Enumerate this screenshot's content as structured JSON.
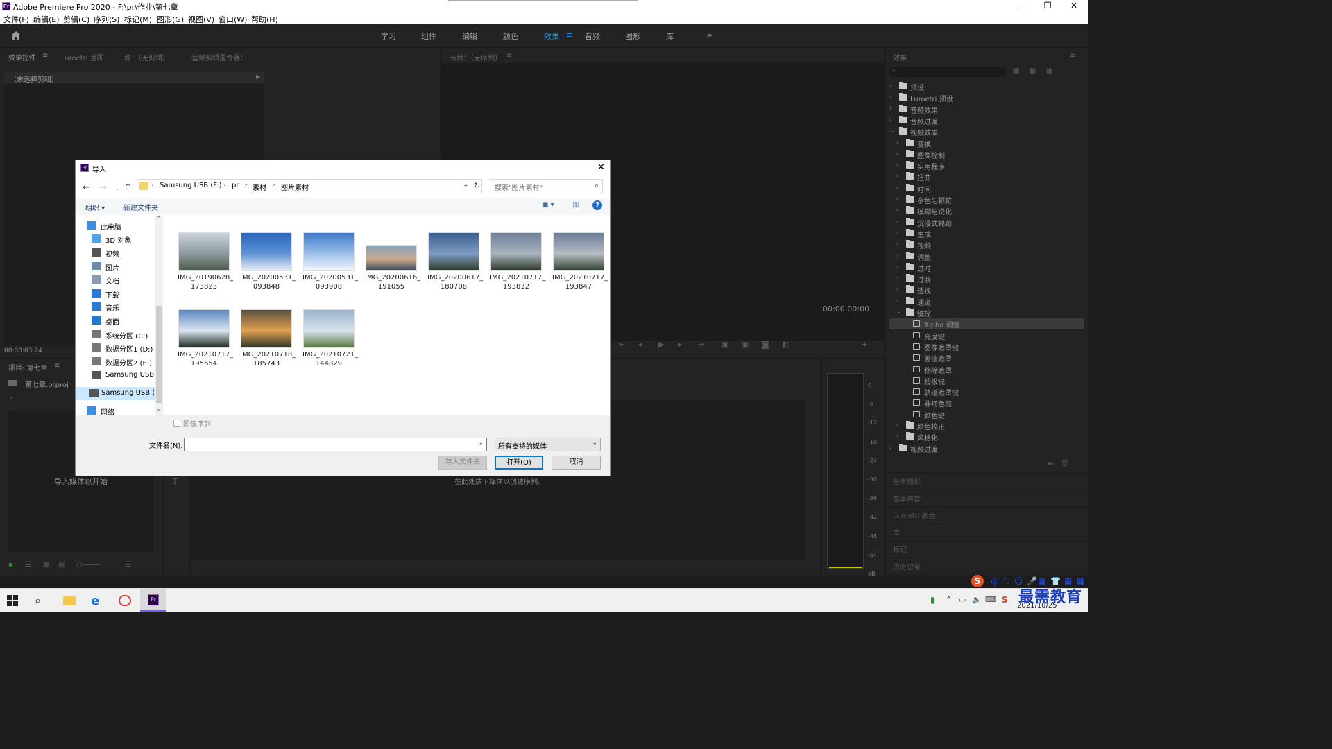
{
  "window": {
    "title": "Adobe Premiere Pro 2020 - F:\\pr\\作业\\第七章",
    "app_icon": "Pr",
    "minimize": "—",
    "maximize": "❐",
    "close": "✕"
  },
  "menu": [
    "文件(F)",
    "编辑(E)",
    "剪辑(C)",
    "序列(S)",
    "标记(M)",
    "图形(G)",
    "视图(V)",
    "窗口(W)",
    "帮助(H)"
  ],
  "workspaces": {
    "tabs": [
      "学习",
      "组件",
      "编辑",
      "颜色",
      "效果",
      "音频",
      "图形",
      "库"
    ],
    "active": "效果",
    "overflow": "»",
    "active_menu": "≡"
  },
  "left_panel": {
    "tabs": [
      "效果控件",
      "Lumetri 范围",
      "源：（无剪辑）",
      "音频剪辑混合器："
    ],
    "tab_menu": "≡",
    "no_clip": "（未选择剪辑）",
    "timecode": "00:00:03:24"
  },
  "program_monitor": {
    "tab": "节目：（无序列）",
    "tab_menu": "≡",
    "timecode": "00:00:00:00"
  },
  "project_panel": {
    "tab": "项目: 第七章",
    "tab_menu": "≡",
    "file": "第七章.prproj",
    "empty_hint": "导入媒体以开始"
  },
  "timeline": {
    "empty_hint": "在此处放下媒体以创建序列。"
  },
  "audio_meter": {
    "scale": [
      "0",
      "-6",
      "-12",
      "-18",
      "-24",
      "-30",
      "-36",
      "-42",
      "-48",
      "-54",
      "dB"
    ]
  },
  "effects_panel": {
    "title": "效果",
    "menu": "≡",
    "tree": [
      {
        "label": "预设",
        "level": 0,
        "expanded": false,
        "type": "folder-special"
      },
      {
        "label": "Lumetri 预设",
        "level": 0,
        "expanded": false,
        "type": "folder-special"
      },
      {
        "label": "音频效果",
        "level": 0,
        "expanded": false,
        "type": "folder"
      },
      {
        "label": "音频过渡",
        "level": 0,
        "expanded": false,
        "type": "folder"
      },
      {
        "label": "视频效果",
        "level": 0,
        "expanded": true,
        "type": "folder"
      },
      {
        "label": "变换",
        "level": 1,
        "expanded": false,
        "type": "folder"
      },
      {
        "label": "图像控制",
        "level": 1,
        "expanded": false,
        "type": "folder"
      },
      {
        "label": "实用程序",
        "level": 1,
        "expanded": false,
        "type": "folder"
      },
      {
        "label": "扭曲",
        "level": 1,
        "expanded": false,
        "type": "folder"
      },
      {
        "label": "时间",
        "level": 1,
        "expanded": false,
        "type": "folder"
      },
      {
        "label": "杂色与颗粒",
        "level": 1,
        "expanded": false,
        "type": "folder"
      },
      {
        "label": "模糊与锐化",
        "level": 1,
        "expanded": false,
        "type": "folder"
      },
      {
        "label": "沉浸式视频",
        "level": 1,
        "expanded": false,
        "type": "folder"
      },
      {
        "label": "生成",
        "level": 1,
        "expanded": false,
        "type": "folder"
      },
      {
        "label": "视频",
        "level": 1,
        "expanded": false,
        "type": "folder"
      },
      {
        "label": "调整",
        "level": 1,
        "expanded": false,
        "type": "folder"
      },
      {
        "label": "过时",
        "level": 1,
        "expanded": false,
        "type": "folder"
      },
      {
        "label": "过渡",
        "level": 1,
        "expanded": false,
        "type": "folder"
      },
      {
        "label": "透视",
        "level": 1,
        "expanded": false,
        "type": "folder"
      },
      {
        "label": "通道",
        "level": 1,
        "expanded": false,
        "type": "folder"
      },
      {
        "label": "键控",
        "level": 1,
        "expanded": true,
        "type": "folder"
      },
      {
        "label": "Alpha 调整",
        "level": 2,
        "type": "effect",
        "selected": true
      },
      {
        "label": "亮度键",
        "level": 2,
        "type": "effect"
      },
      {
        "label": "图像遮罩键",
        "level": 2,
        "type": "effect"
      },
      {
        "label": "差值遮罩",
        "level": 2,
        "type": "effect"
      },
      {
        "label": "移除遮罩",
        "level": 2,
        "type": "effect"
      },
      {
        "label": "超级键",
        "level": 2,
        "type": "effect"
      },
      {
        "label": "轨道遮罩键",
        "level": 2,
        "type": "effect"
      },
      {
        "label": "非红色键",
        "level": 2,
        "type": "effect"
      },
      {
        "label": "颜色键",
        "level": 2,
        "type": "effect"
      },
      {
        "label": "颜色校正",
        "level": 1,
        "expanded": false,
        "type": "folder"
      },
      {
        "label": "风格化",
        "level": 1,
        "expanded": false,
        "type": "folder"
      },
      {
        "label": "视频过渡",
        "level": 0,
        "expanded": false,
        "type": "folder"
      }
    ],
    "collapsed_panels": [
      "基本图形",
      "基本声音",
      "Lumetri 颜色",
      "库",
      "标记",
      "历史记录"
    ]
  },
  "dialog": {
    "title": "导入",
    "close": "✕",
    "breadcrumb": [
      "Samsung USB (F:)",
      "pr",
      "素材",
      "图片素材"
    ],
    "search_placeholder": "搜索\"图片素材\"",
    "organize": "组织 ▾",
    "new_folder": "新建文件夹",
    "help": "?",
    "nav": [
      {
        "label": "此电脑",
        "icon": "computer-icon",
        "indent": 0
      },
      {
        "label": "3D 对象",
        "icon": "3d-objects-icon",
        "indent": 1
      },
      {
        "label": "视频",
        "icon": "video-icon",
        "indent": 1
      },
      {
        "label": "图片",
        "icon": "picture-icon",
        "indent": 1
      },
      {
        "label": "文档",
        "icon": "document-icon",
        "indent": 1
      },
      {
        "label": "下载",
        "icon": "download-icon",
        "indent": 1
      },
      {
        "label": "音乐",
        "icon": "music-icon",
        "indent": 1
      },
      {
        "label": "桌面",
        "icon": "desktop-icon",
        "indent": 1
      },
      {
        "label": "系统分区 (C:)",
        "icon": "drive-icon",
        "indent": 1
      },
      {
        "label": "数据分区1 (D:)",
        "icon": "drive-icon",
        "indent": 1
      },
      {
        "label": "数据分区2 (E:)",
        "icon": "drive-icon",
        "indent": 1
      },
      {
        "label": "Samsung USB",
        "icon": "usb-drive-icon",
        "indent": 1
      },
      {
        "label": "Samsung USB (F",
        "icon": "usb-drive-icon",
        "indent": 0,
        "selected": true
      },
      {
        "label": "网络",
        "icon": "network-icon",
        "indent": 0
      }
    ],
    "files": [
      {
        "name": "IMG_20190628_\n173823",
        "palette": [
          "#c9d2d8",
          "#8c9aa0",
          "#4d5a4a"
        ]
      },
      {
        "name": "IMG_20200531_\n093848",
        "palette": [
          "#2a66b8",
          "#5f93d6",
          "#e6eef8"
        ]
      },
      {
        "name": "IMG_20200531_\n093908",
        "palette": [
          "#3f79c9",
          "#9cc0ea",
          "#f2f5fa"
        ]
      },
      {
        "name": "IMG_20200616_\n191055",
        "palette": [
          "#8aa3bf",
          "#c9a98c",
          "#3a4a5a"
        ]
      },
      {
        "name": "IMG_20200617_\n180708",
        "palette": [
          "#3c5f8f",
          "#7d9bc2",
          "#2d3d28"
        ]
      },
      {
        "name": "IMG_20210717_\n193832",
        "palette": [
          "#6f8098",
          "#a9b3bf",
          "#2e3a2a"
        ]
      },
      {
        "name": "IMG_20210717_\n193847",
        "palette": [
          "#6a7d96",
          "#b5bcc4",
          "#334230"
        ]
      },
      {
        "name": "IMG_20210717_\n195654",
        "palette": [
          "#5b87c0",
          "#d9e4ef",
          "#1e2a20"
        ]
      },
      {
        "name": "IMG_20210718_\n185743",
        "palette": [
          "#5a5040",
          "#e0a050",
          "#2f3526"
        ]
      },
      {
        "name": "IMG_20210721_\n144829",
        "palette": [
          "#9ab4cc",
          "#d8e2ec",
          "#5a7a40"
        ]
      }
    ],
    "image_sequence": "图像序列",
    "filename_label": "文件名(N):",
    "filename_value": "",
    "filetype": "所有支持的媒体",
    "import_folder": "导入文件夹",
    "open": "打开(O)",
    "cancel": "取消"
  },
  "taskbar": {
    "date": "2021/10/25",
    "ime": "中",
    "watermark": "最需教育"
  },
  "colors": {
    "accent": "#2d8ceb",
    "panel": "#232323",
    "bg": "#1d1d1d"
  }
}
